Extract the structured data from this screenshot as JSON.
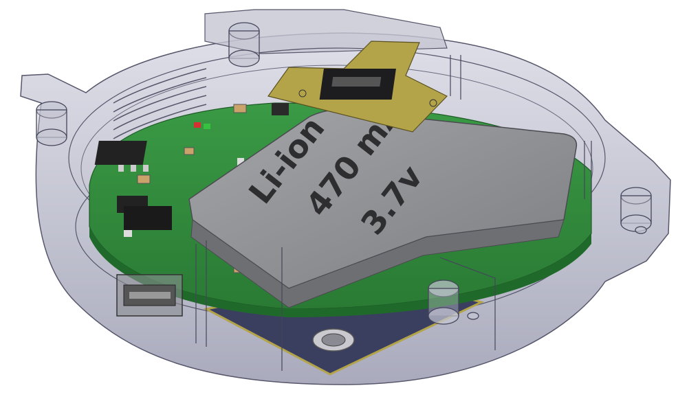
{
  "battery": {
    "type_label": "Li-ion",
    "capacity_label": "470 mAh",
    "voltage_label": "3.7v"
  },
  "colors": {
    "housing": "#b8b9c9",
    "housing_edge": "#5a5a6a",
    "pcb": "#2f8a3a",
    "pcb_dark": "#1f6a2a",
    "battery": "#8c8d90",
    "flex_pcb": "#b3a44a",
    "bottom_board": "#3a3f60"
  }
}
